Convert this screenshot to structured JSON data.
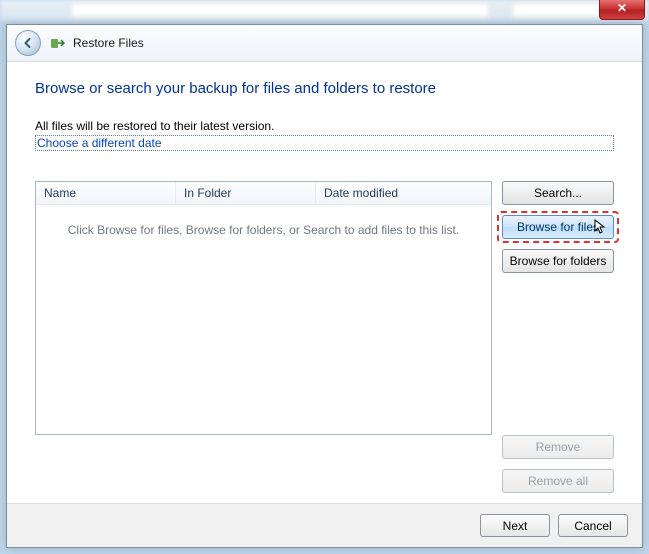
{
  "chrome": {
    "close_label": "✕"
  },
  "header": {
    "title": "Restore Files"
  },
  "body": {
    "heading": "Browse or search your backup for files and folders to restore",
    "info": "All files will be restored to their latest version.",
    "link": "Choose a different date"
  },
  "listview": {
    "columns": {
      "name": "Name",
      "folder": "In Folder",
      "date": "Date modified"
    },
    "empty": "Click Browse for files, Browse for folders, or Search to add files to this list."
  },
  "buttons": {
    "search": "Search...",
    "browse_files": "Browse for files",
    "browse_folders": "Browse for folders",
    "remove": "Remove",
    "remove_all": "Remove all"
  },
  "footer": {
    "next": "Next",
    "cancel": "Cancel"
  }
}
